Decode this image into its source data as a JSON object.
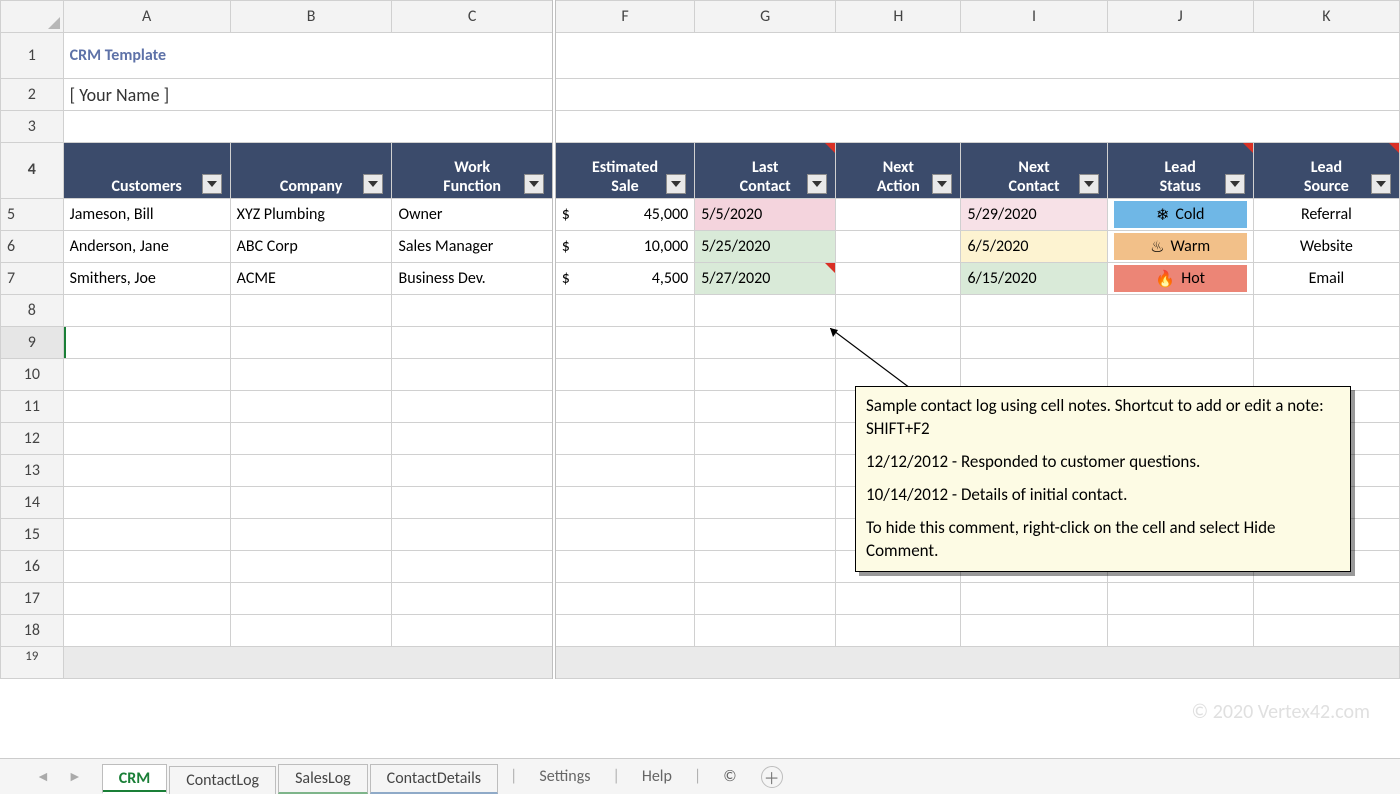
{
  "columns": [
    "A",
    "B",
    "C",
    "F",
    "G",
    "H",
    "I",
    "J",
    "K"
  ],
  "title": "CRM Template",
  "subtitle": "[ Your Name ]",
  "headers": {
    "customers": "Customers",
    "company": "Company",
    "work_function": "Work\nFunction",
    "estimated_sale": "Estimated\nSale",
    "last_contact": "Last\nContact",
    "next_action": "Next\nAction",
    "next_contact": "Next\nContact",
    "lead_status": "Lead\nStatus",
    "lead_source": "Lead\nSource"
  },
  "rows": [
    {
      "n": 5,
      "customer": "Jameson, Bill",
      "company": "XYZ Plumbing",
      "function": "Owner",
      "sale_currency": "$",
      "sale": "45,000",
      "last_contact": "5/5/2020",
      "last_contact_class": "lc-pink",
      "next_action": "",
      "next_contact": "5/29/2020",
      "next_contact_class": "nc-pink",
      "status": "Cold",
      "status_icon": "❄",
      "status_class": "pill-cold",
      "source": "Referral"
    },
    {
      "n": 6,
      "customer": "Anderson, Jane",
      "company": "ABC Corp",
      "function": "Sales Manager",
      "sale_currency": "$",
      "sale": "10,000",
      "last_contact": "5/25/2020",
      "last_contact_class": "lc-ltgrn",
      "next_action": "",
      "next_contact": "6/5/2020",
      "next_contact_class": "nc-yel",
      "status": "Warm",
      "status_icon": "♨",
      "status_class": "pill-warm",
      "source": "Website"
    },
    {
      "n": 7,
      "customer": "Smithers, Joe",
      "company": "ACME",
      "function": "Business Dev.",
      "sale_currency": "$",
      "sale": "4,500",
      "last_contact": "5/27/2020",
      "last_contact_class": "lc-ltgrn",
      "next_action": "",
      "next_contact": "6/15/2020",
      "next_contact_class": "nc-grn",
      "status": "Hot",
      "status_icon": "🔥",
      "status_class": "pill-hot",
      "source": "Email"
    }
  ],
  "empty_rows": [
    8,
    9,
    10,
    11,
    12,
    13,
    14,
    15,
    16,
    17,
    18
  ],
  "selected_row": 9,
  "comment": {
    "lines": [
      "Sample contact log using cell notes. Shortcut to add or edit a note: SHIFT+F2",
      "",
      "12/12/2012 - Responded to customer questions.",
      "",
      "10/14/2012 - Details of initial contact.",
      "",
      "To hide this comment, right-click on the cell and select Hide Comment."
    ]
  },
  "tabs": {
    "items": [
      {
        "label": "CRM",
        "active": true
      },
      {
        "label": "ContactLog"
      },
      {
        "label": "SalesLog",
        "accent": "green"
      },
      {
        "label": "ContactDetails",
        "accent": "blue"
      }
    ],
    "extras": [
      "Settings",
      "Help",
      "©"
    ]
  },
  "watermark": "© 2020 Vertex42.com"
}
